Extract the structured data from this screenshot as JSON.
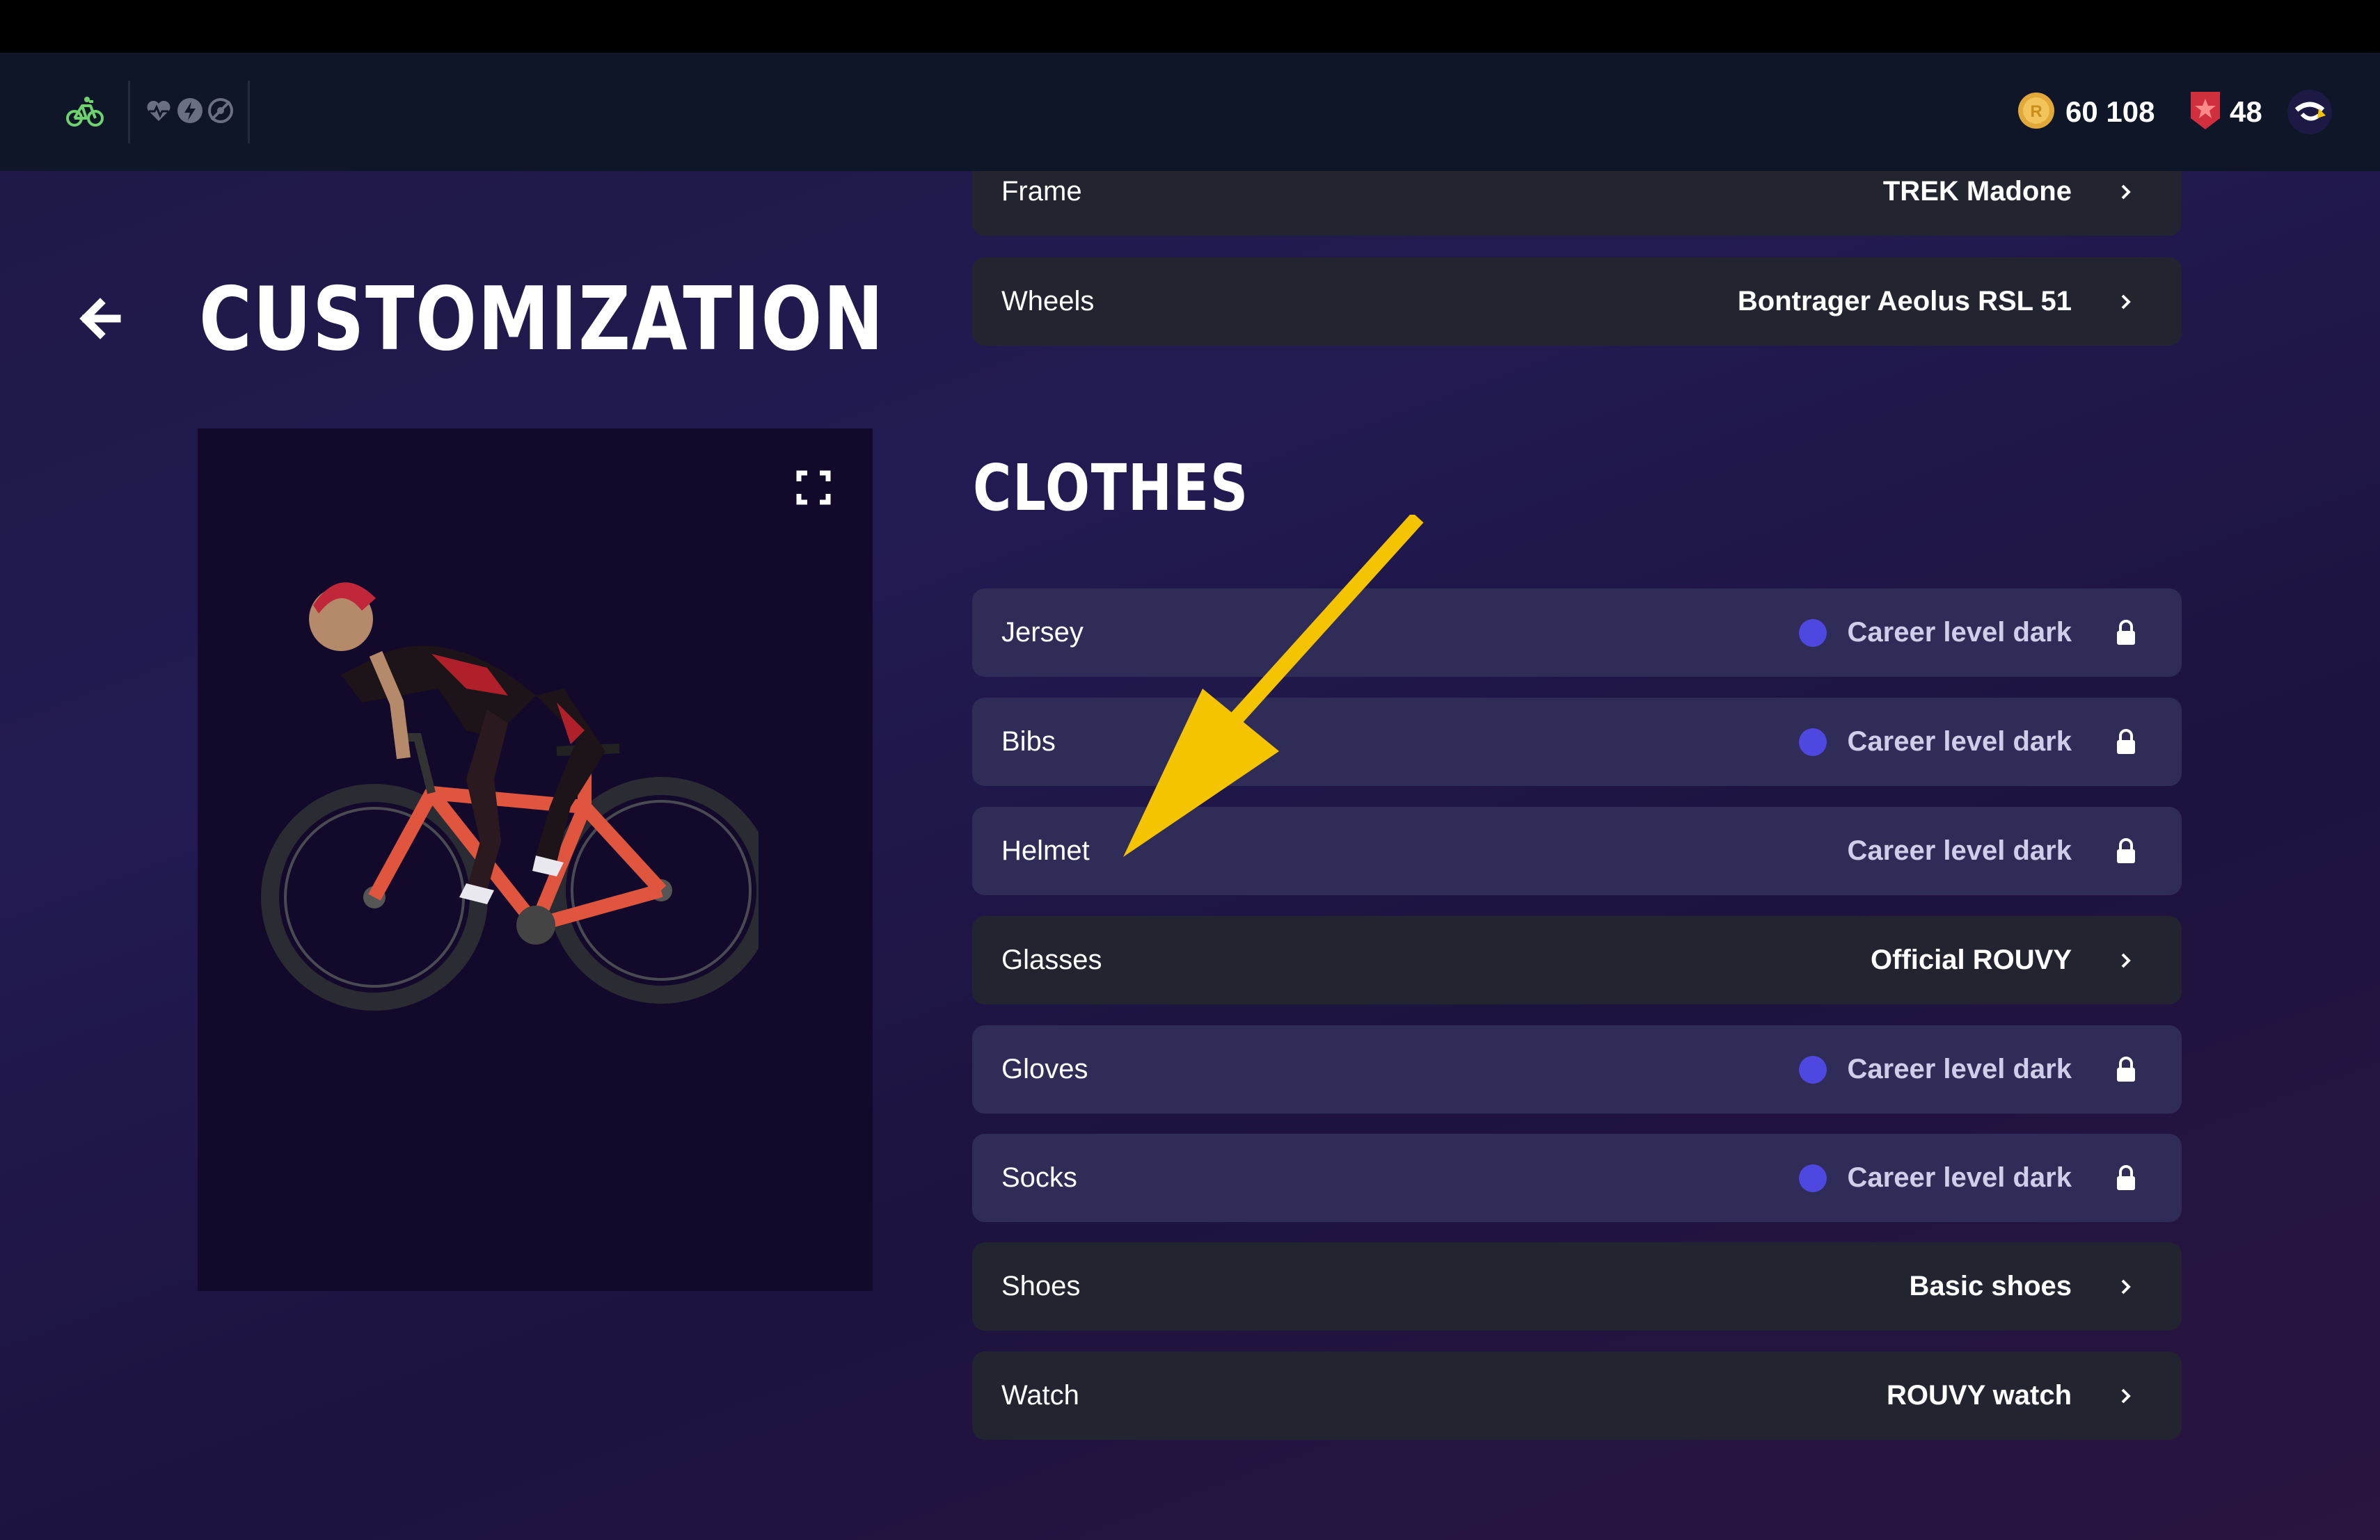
{
  "topbar": {
    "bike_icon": "bike-icon",
    "sensor_icons": [
      "heart-rate-icon",
      "power-icon",
      "cadence-icon"
    ],
    "coins": "60 108",
    "coin_icon": "coin-icon",
    "level": "48",
    "level_icon": "level-badge-icon",
    "avatar_icon": "rouvy-logo-icon"
  },
  "header": {
    "title": "CUSTOMIZATION",
    "back_icon": "arrow-left-icon"
  },
  "preview": {
    "fullscreen_icon": "fullscreen-icon"
  },
  "bike_items": [
    {
      "label": "Frame",
      "value": "TREK Madone",
      "icon": "chevron-right-icon",
      "locked": false,
      "dot": false
    },
    {
      "label": "Wheels",
      "value": "Bontrager Aeolus RSL 51",
      "icon": "chevron-right-icon",
      "locked": false,
      "dot": false
    }
  ],
  "clothes": {
    "title": "CLOTHES",
    "items": [
      {
        "label": "Jersey",
        "value": "Career level dark",
        "icon": "lock-icon",
        "locked": true,
        "dot": true
      },
      {
        "label": "Bibs",
        "value": "Career level dark",
        "icon": "lock-icon",
        "locked": true,
        "dot": true
      },
      {
        "label": "Helmet",
        "value": "Career level dark",
        "icon": "lock-icon",
        "locked": true,
        "dot": false
      },
      {
        "label": "Glasses",
        "value": "Official ROUVY",
        "icon": "chevron-right-icon",
        "locked": false,
        "dot": false
      },
      {
        "label": "Gloves",
        "value": "Career level dark",
        "icon": "lock-icon",
        "locked": true,
        "dot": true
      },
      {
        "label": "Socks",
        "value": "Career level dark",
        "icon": "lock-icon",
        "locked": true,
        "dot": true
      },
      {
        "label": "Shoes",
        "value": "Basic shoes",
        "icon": "chevron-right-icon",
        "locked": false,
        "dot": false
      },
      {
        "label": "Watch",
        "value": "ROUVY watch",
        "icon": "chevron-right-icon",
        "locked": false,
        "dot": false
      }
    ]
  },
  "colors": {
    "accent_dot": "#4e48e0",
    "locked_row": "#302c58",
    "row": "#22242f",
    "annotation_arrow": "#f5c400"
  }
}
